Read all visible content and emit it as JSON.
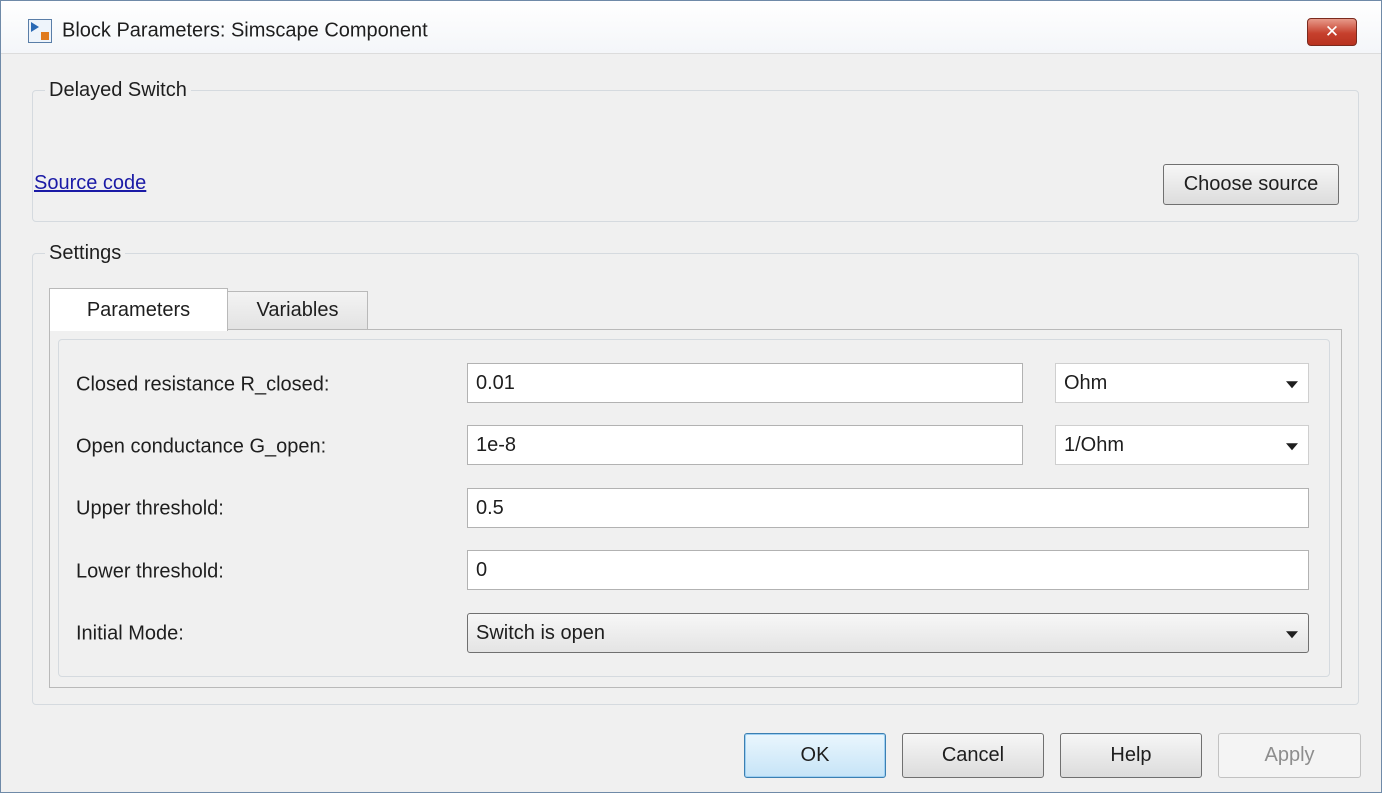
{
  "window": {
    "title": "Block Parameters: Simscape Component"
  },
  "component_group": {
    "legend": "Delayed Switch",
    "source_link": "Source code",
    "choose_source_label": "Choose source"
  },
  "settings_group": {
    "legend": "Settings",
    "tabs": [
      {
        "label": "Parameters",
        "active": true
      },
      {
        "label": "Variables",
        "active": false
      }
    ],
    "parameters": [
      {
        "label": "Closed resistance R_closed:",
        "value": "0.01",
        "unit": "Ohm"
      },
      {
        "label": "Open conductance G_open:",
        "value": "1e-8",
        "unit": "1/Ohm"
      },
      {
        "label": "Upper threshold:",
        "value": "0.5"
      },
      {
        "label": "Lower threshold:",
        "value": "0"
      },
      {
        "label": "Initial Mode:",
        "value": "Switch is open"
      }
    ]
  },
  "buttons": {
    "ok": "OK",
    "cancel": "Cancel",
    "help": "Help",
    "apply": "Apply"
  },
  "colors": {
    "link": "#1a1aa6",
    "close_button": "#c6402d",
    "primary_button_border": "#3c7fb1"
  }
}
